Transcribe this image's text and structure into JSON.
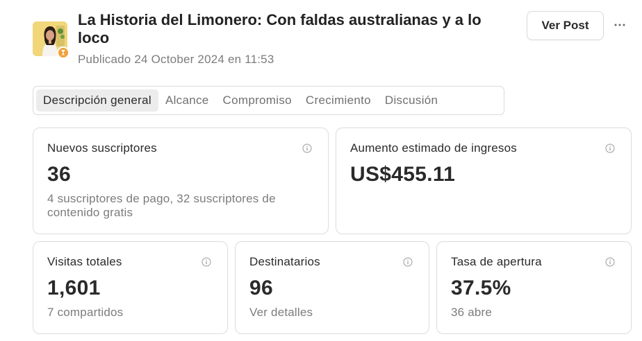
{
  "post": {
    "title": "La Historia del Limonero: Con faldas australianas y a lo loco",
    "published": "Publicado 24 October 2024 en 11:53",
    "view_post_label": "Ver Post",
    "more_label": "···"
  },
  "tabs": [
    {
      "label": "Descripción general",
      "active": true
    },
    {
      "label": "Alcance",
      "active": false
    },
    {
      "label": "Compromiso",
      "active": false
    },
    {
      "label": "Crecimiento",
      "active": false
    },
    {
      "label": "Discusión",
      "active": false
    }
  ],
  "cards": {
    "subscribers": {
      "label": "Nuevos suscriptores",
      "value": "36",
      "sub": "4 suscriptores de pago, 32 suscriptores de contenido gratis"
    },
    "revenue": {
      "label": "Aumento estimado de ingresos",
      "value": "US$455.11"
    },
    "views": {
      "label": "Visitas totales",
      "value": "1,601",
      "sub": "7 compartidos"
    },
    "recipients": {
      "label": "Destinatarios",
      "value": "96",
      "sub": "Ver detalles"
    },
    "open_rate": {
      "label": "Tasa de apertura",
      "value": "37.5%",
      "sub": "36 abre"
    }
  },
  "icons": {
    "info": "info-icon",
    "more": "more-icon",
    "badge": "badge-icon"
  },
  "colors": {
    "badge": "#f3a13c",
    "muted_text": "#7c7c7c",
    "active_tab_bg": "#ececec"
  }
}
